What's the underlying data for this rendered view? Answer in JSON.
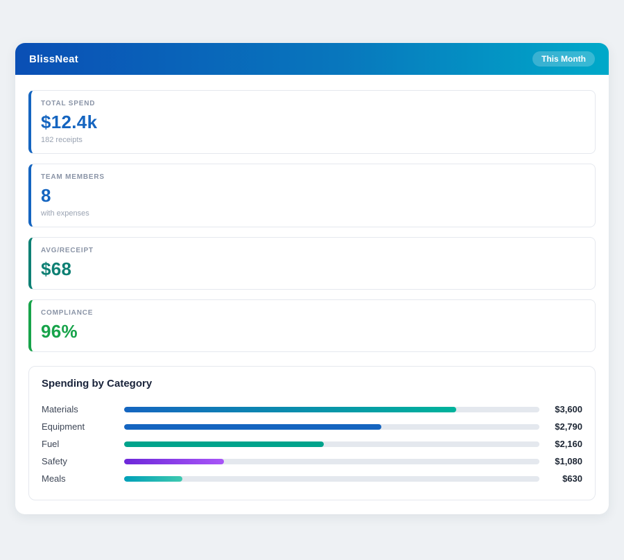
{
  "header": {
    "app_name": "BlissNeat",
    "badge_label": "This Month"
  },
  "stats": [
    {
      "label": "TOTAL SPEND",
      "value": "$12.4k",
      "sub": "182 receipts",
      "accent": "#1565c0",
      "value_color": "#1565c0"
    },
    {
      "label": "TEAM MEMBERS",
      "value": "8",
      "sub": "with expenses",
      "accent": "#1565c0",
      "value_color": "#1565c0"
    },
    {
      "label": "AVG/RECEIPT",
      "value": "$68",
      "sub": "",
      "accent": "#0e8074",
      "value_color": "#0e8074"
    },
    {
      "label": "COMPLIANCE",
      "value": "96%",
      "sub": "",
      "accent": "#17a34a",
      "value_color": "#17a34a"
    }
  ],
  "category_section": {
    "title": "Spending by Category",
    "rows": [
      {
        "label": "Materials",
        "value": "$3,600",
        "pct": 80,
        "color1": "#1565c0",
        "color2": "#00b39b"
      },
      {
        "label": "Equipment",
        "value": "$2,790",
        "pct": 62,
        "color1": "#1565c0",
        "color2": ""
      },
      {
        "label": "Fuel",
        "value": "$2,160",
        "pct": 48,
        "color1": "#00a38c",
        "color2": ""
      },
      {
        "label": "Safety",
        "value": "$1,080",
        "pct": 24,
        "color1": "#6d28d9",
        "color2": "#a855f7"
      },
      {
        "label": "Meals",
        "value": "$630",
        "pct": 14,
        "color1": "#00a0b8",
        "color2": "#3ec9b0"
      }
    ]
  },
  "chart_data": {
    "type": "bar",
    "title": "Spending by Category",
    "categories": [
      "Materials",
      "Equipment",
      "Fuel",
      "Safety",
      "Meals"
    ],
    "values": [
      3600,
      2790,
      2160,
      1080,
      630
    ],
    "value_labels": [
      "$3,600",
      "$2,790",
      "$2,160",
      "$1,080",
      "$630"
    ],
    "xlabel": "",
    "ylabel": "",
    "legend": "none",
    "grid": false
  },
  "colors": {
    "header_gradient_start": "#0a4fb5",
    "header_gradient_end": "#00a9c9",
    "primary_blue": "#1565c0",
    "teal": "#0e8074",
    "green": "#17a34a",
    "purple": "#7c3aed",
    "track": "#e4e8ee"
  }
}
